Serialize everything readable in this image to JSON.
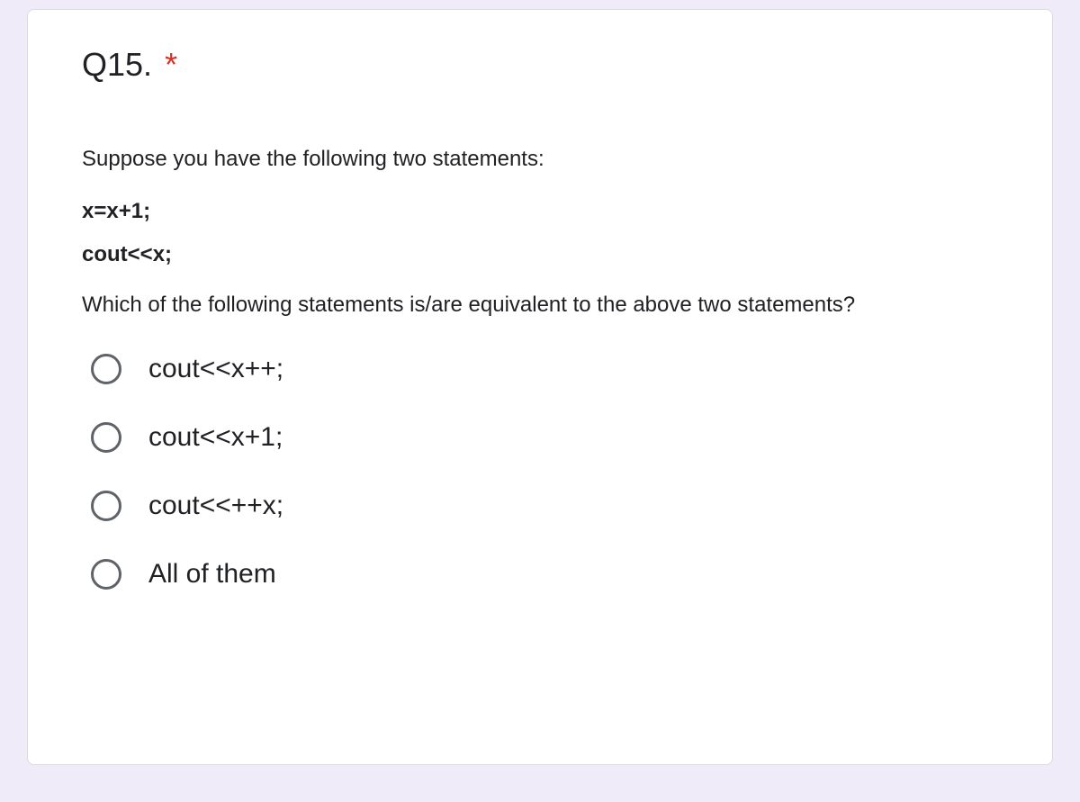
{
  "question": {
    "number": "Q15.",
    "required_marker": "*",
    "prompt_intro": "Suppose you have the following two statements:",
    "code_line_1": "x=x+1;",
    "code_line_2": "cout<<x;",
    "prompt_question": "Which of the following statements is/are equivalent to the above two statements?",
    "options": [
      "cout<<x++;",
      "cout<<x+1;",
      "cout<<++x;",
      "All of them"
    ]
  }
}
